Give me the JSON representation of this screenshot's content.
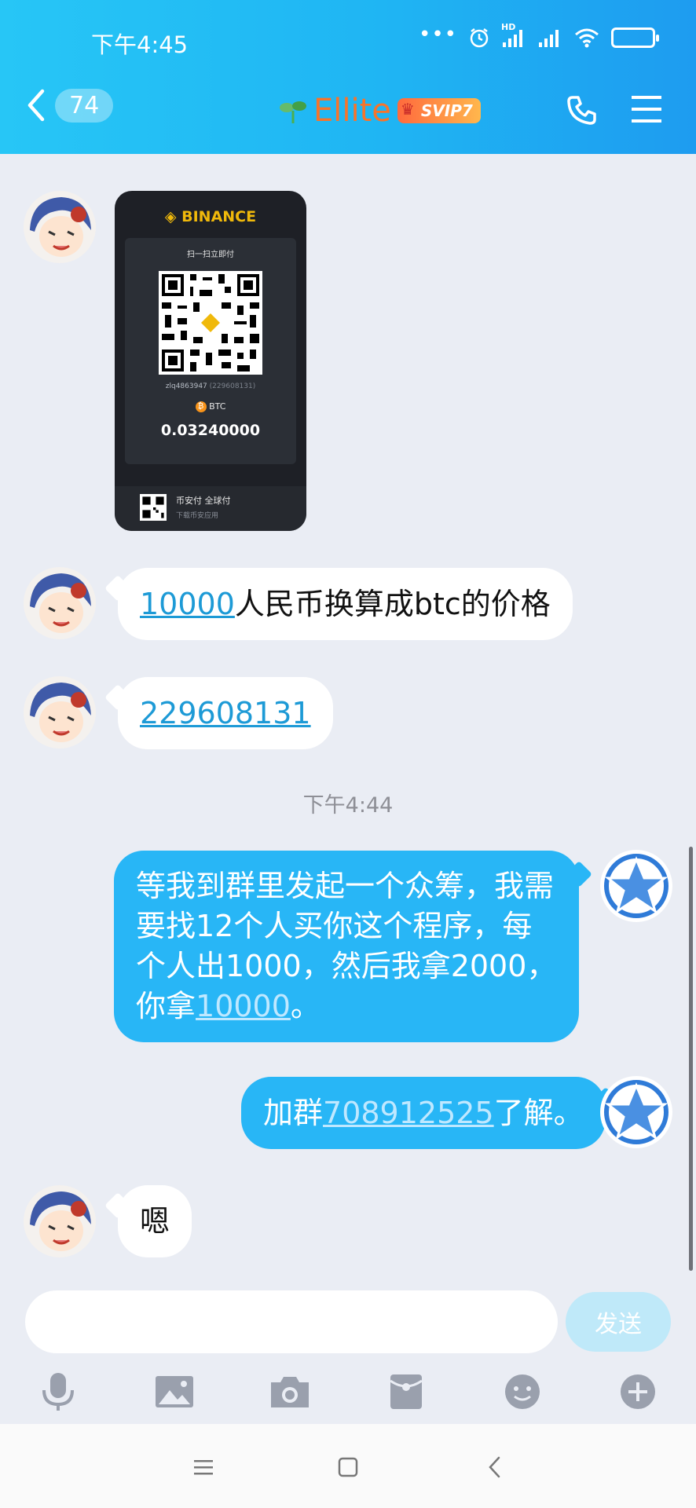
{
  "status_bar": {
    "time": "下午4:45",
    "hd_label": "HD"
  },
  "header": {
    "unread_count": "74",
    "title": "Ellite",
    "vip_badge": "SVIP7",
    "title_color": "#f7742b"
  },
  "messages": [
    {
      "sender": "other",
      "type": "image",
      "binance": {
        "brand": "BINANCE",
        "scan_text": "扫一扫立即付",
        "user": "zlq4863947",
        "user_id": "(229608131)",
        "coin": "BTC",
        "amount": "0.03240000",
        "footer_title": "币安付 全球付",
        "footer_sub": "下载币安应用"
      }
    },
    {
      "sender": "other",
      "type": "text",
      "link": "10000",
      "text": "人民币换算成btc的价格"
    },
    {
      "sender": "other",
      "type": "text",
      "link": "229608131"
    },
    {
      "sender": "me",
      "type": "text",
      "text": "等我到群里发起一个众筹，我需要找12个人买你这个程序，每个人出1000，然后我拿2000，你拿",
      "link": "10000",
      "suffix": "。"
    },
    {
      "sender": "me",
      "type": "text",
      "prefix": "加群",
      "link": "708912525",
      "suffix": "了解。"
    },
    {
      "sender": "other",
      "type": "text",
      "text": "嗯"
    }
  ],
  "timestamp": "下午4:44",
  "input": {
    "placeholder": "",
    "value": "",
    "send_label": "发送"
  },
  "toolbar": [
    "microphone-icon",
    "image-icon",
    "camera-icon",
    "red-packet-icon",
    "emoji-icon",
    "plus-icon"
  ],
  "colors": {
    "header": "#1fb5f3",
    "outgoing_bubble": "#28b6f6",
    "background": "#eaedf4",
    "link_incoming": "#1d9ad6"
  }
}
